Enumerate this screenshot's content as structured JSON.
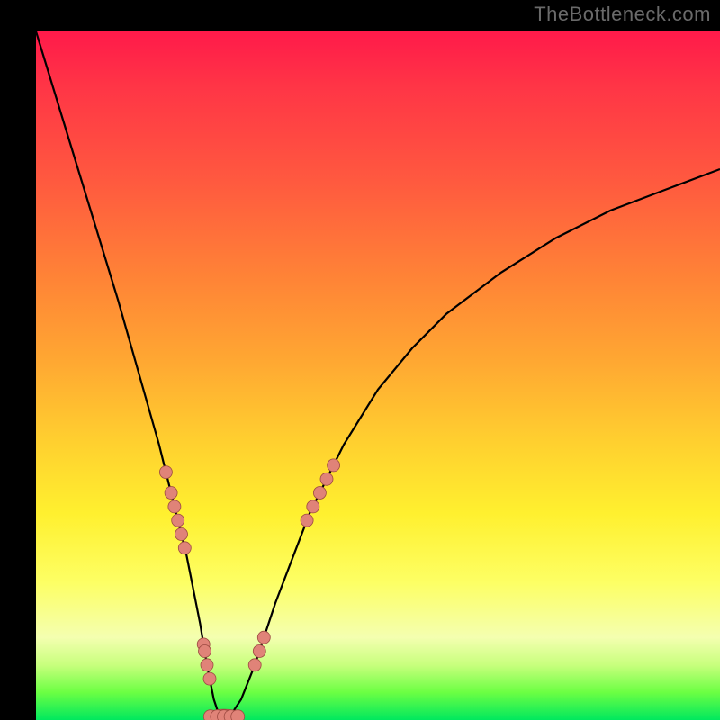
{
  "watermark": "TheBottleneck.com",
  "chart_data": {
    "type": "line",
    "title": "",
    "xlabel": "",
    "ylabel": "",
    "xlim": [
      0,
      100
    ],
    "ylim": [
      0,
      100
    ],
    "grid": false,
    "legend": false,
    "series": [
      {
        "name": "bottleneck-curve",
        "x": [
          0,
          4,
          8,
          12,
          16,
          18,
          20,
          22,
          24,
          25,
          26,
          27,
          28,
          30,
          32,
          35,
          40,
          45,
          50,
          55,
          60,
          68,
          76,
          84,
          92,
          100
        ],
        "values": [
          100,
          87,
          74,
          61,
          47,
          40,
          32,
          24,
          14,
          8,
          3,
          0,
          0,
          3,
          8,
          17,
          30,
          40,
          48,
          54,
          59,
          65,
          70,
          74,
          77,
          80
        ]
      }
    ],
    "markers": {
      "left_wall": [
        36,
        33,
        31,
        29,
        27,
        25,
        11,
        10,
        8,
        6
      ],
      "right_wall": [
        37,
        35,
        33,
        31,
        29,
        12,
        10,
        8
      ],
      "floor_y": 0.5,
      "floor_x": [
        25.5,
        26.5,
        27.5,
        28.5,
        29.5
      ]
    },
    "annotations": []
  },
  "colors": {
    "curve": "#000000",
    "dot_fill": "#e08378",
    "dot_stroke": "#9c4a41",
    "gradient_top": "#ff1a4a",
    "gradient_bottom": "#00e85e"
  }
}
